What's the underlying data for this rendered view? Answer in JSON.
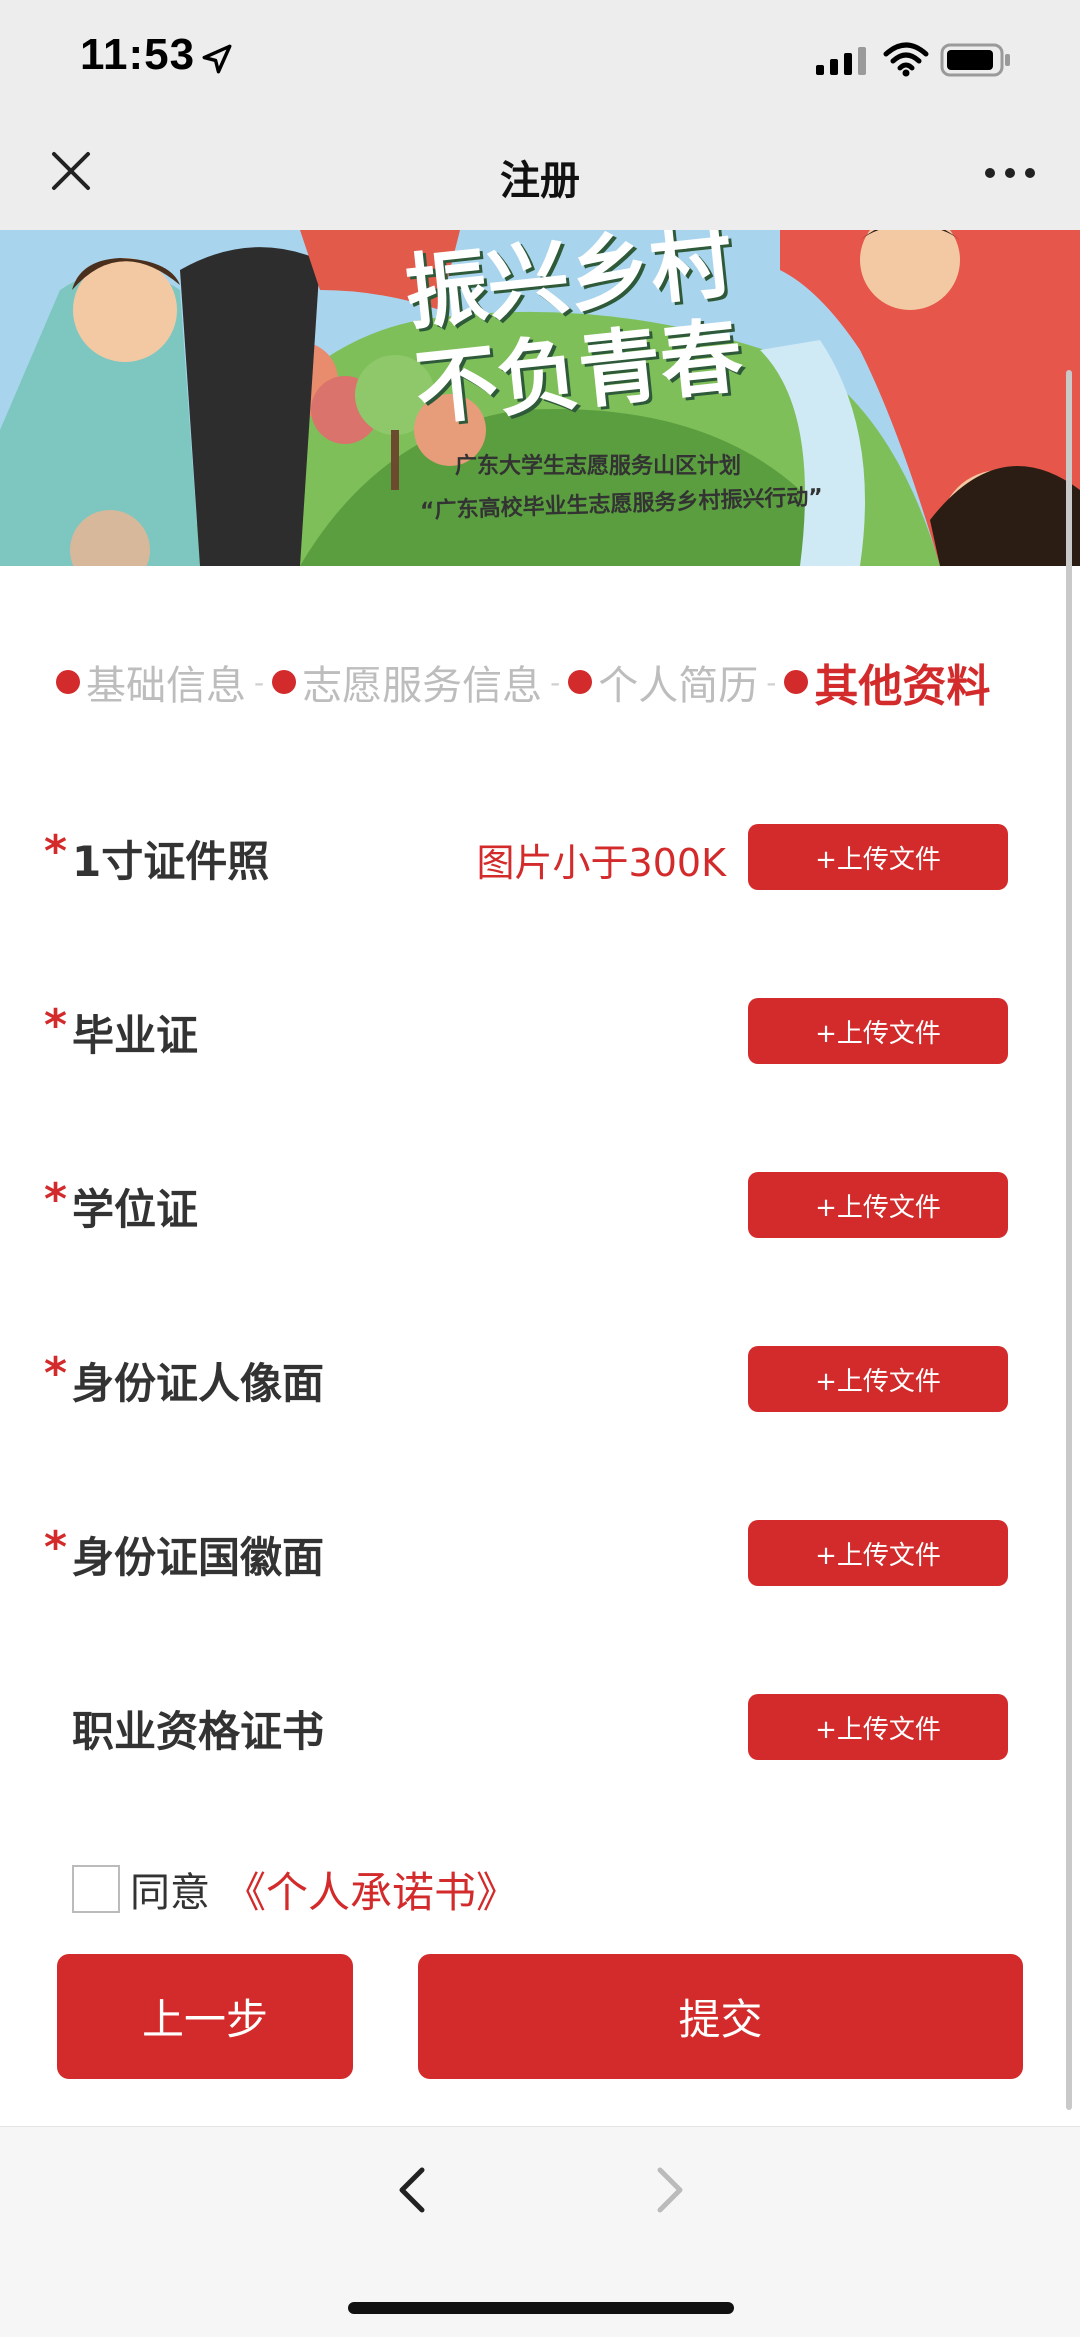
{
  "status_bar": {
    "time": "11:53",
    "icons": [
      "location-arrow-icon",
      "cellular-signal-icon",
      "wifi-icon",
      "battery-icon"
    ]
  },
  "nav": {
    "title": "注册",
    "left_icon": "close-icon",
    "right_icon": "more-icon"
  },
  "banner": {
    "title_line1": "振兴乡村",
    "title_line2": "不负青春",
    "subtitle1": "广东大学生志愿服务山区计划",
    "subtitle2": "“广东高校毕业生志愿服务乡村振兴行动”"
  },
  "steps": [
    {
      "label": "基础信息",
      "active": false
    },
    {
      "label": "志愿服务信息",
      "active": false
    },
    {
      "label": "个人简历",
      "active": false
    },
    {
      "label": "其他资料",
      "active": true
    }
  ],
  "step_separator": "-",
  "upload_rows": [
    {
      "required": true,
      "label": "1寸证件照",
      "hint": "图片小于300K",
      "button": "+上传文件"
    },
    {
      "required": true,
      "label": "毕业证",
      "hint": "",
      "button": "+上传文件"
    },
    {
      "required": true,
      "label": "学位证",
      "hint": "",
      "button": "+上传文件"
    },
    {
      "required": true,
      "label": "身份证人像面",
      "hint": "",
      "button": "+上传文件"
    },
    {
      "required": true,
      "label": "身份证国徽面",
      "hint": "",
      "button": "+上传文件"
    },
    {
      "required": false,
      "label": "职业资格证书",
      "hint": "",
      "button": "+上传文件"
    }
  ],
  "required_mark": "*",
  "agreement": {
    "checked": false,
    "text": "同意",
    "link": "《个人承诺书》"
  },
  "buttons": {
    "prev": "上一步",
    "submit": "提交"
  },
  "bottom_bar": {
    "back_icon": "chevron-left-icon",
    "forward_icon": "chevron-right-icon"
  },
  "colors": {
    "accent": "#d32b2b",
    "nav_bg": "#ededed",
    "inactive_step": "#bdbdbd"
  }
}
